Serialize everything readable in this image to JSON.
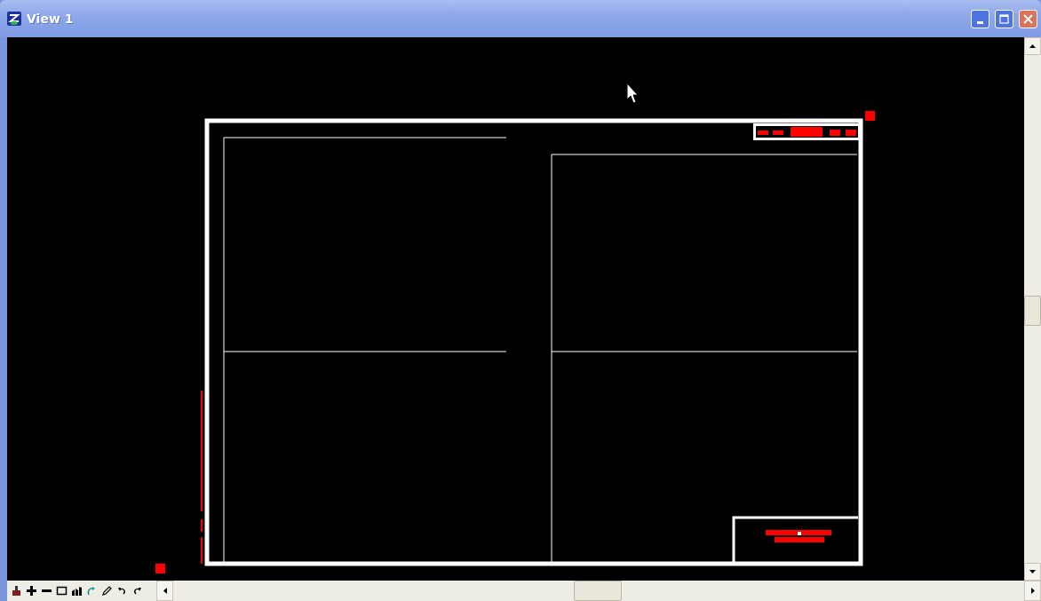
{
  "window": {
    "title": "View 1"
  }
}
